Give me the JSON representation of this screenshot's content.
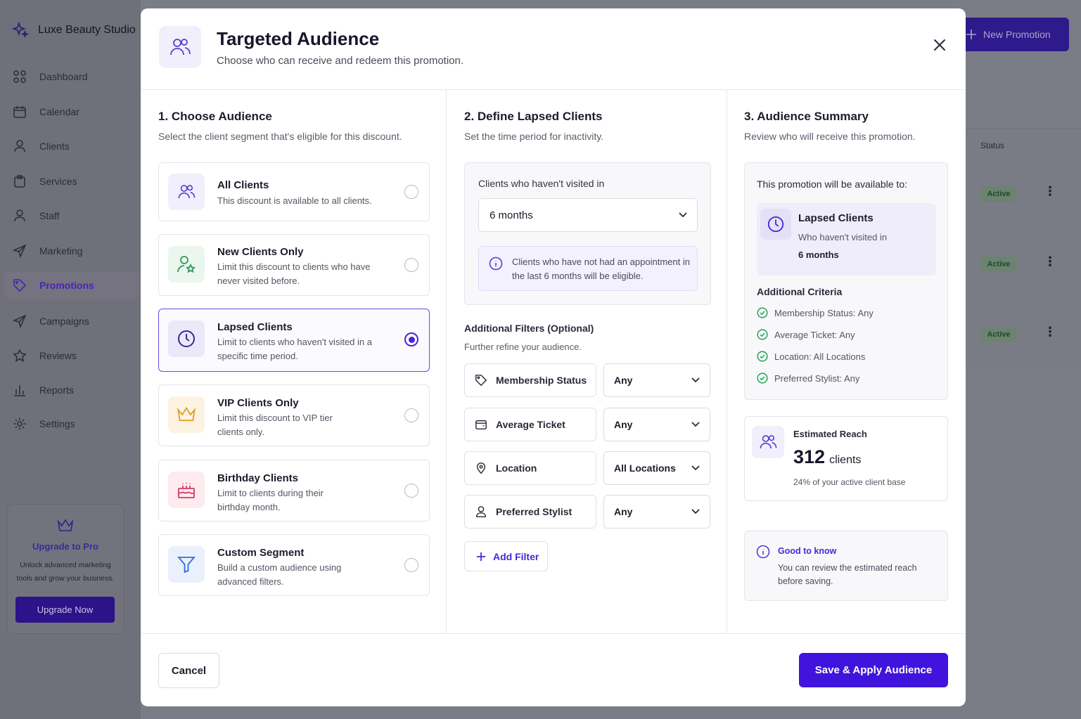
{
  "app": {
    "brand": "Luxe Beauty Studio",
    "new_promotion": "New Promotion",
    "nav": [
      {
        "label": "Dashboard"
      },
      {
        "label": "Calendar"
      },
      {
        "label": "Clients"
      },
      {
        "label": "Services"
      },
      {
        "label": "Staff"
      },
      {
        "label": "Marketing"
      },
      {
        "label": "Promotions",
        "active": true
      },
      {
        "label": "Campaigns"
      },
      {
        "label": "Reviews"
      },
      {
        "label": "Reports"
      },
      {
        "label": "Settings"
      }
    ],
    "upgrade": {
      "title": "Upgrade to Pro",
      "text": "Unlock advanced marketing tools and grow your business.",
      "button": "Upgrade Now"
    },
    "table": {
      "status_header": "Status",
      "rows": [
        {
          "status": "Active"
        },
        {
          "status": "Active"
        },
        {
          "status": "Active"
        }
      ]
    }
  },
  "modal": {
    "title": "Targeted Audience",
    "subtitle": "Choose who can receive and redeem this promotion.",
    "step1": {
      "heading": "1. Choose Audience",
      "sub": "Select the client segment that's eligible for this discount.",
      "options": [
        {
          "title": "All Clients",
          "desc": "This discount is available to all clients.",
          "icon": "users-icon",
          "selected": false
        },
        {
          "title": "New Clients Only",
          "desc": "Limit this discount to clients who have never visited before.",
          "icon": "user-star-icon",
          "selected": false
        },
        {
          "title": "Lapsed Clients",
          "desc": "Limit to clients who haven't visited in a specific time period.",
          "icon": "clock-icon",
          "selected": true
        },
        {
          "title": "VIP Clients Only",
          "desc": "Limit this discount to VIP tier clients only.",
          "icon": "crown-icon",
          "selected": false
        },
        {
          "title": "Birthday Clients",
          "desc": "Limit to clients during their birthday month.",
          "icon": "cake-icon",
          "selected": false
        },
        {
          "title": "Custom Segment",
          "desc": "Build a custom audience using advanced filters.",
          "icon": "filter-icon",
          "selected": false
        }
      ]
    },
    "step2": {
      "heading": "2. Define Lapsed Clients",
      "sub": "Set the time period for inactivity.",
      "period_label": "Clients who haven't visited in",
      "period_value": "6 months",
      "info": "Clients who have not had an appointment in the last 6 months will be eligible.",
      "filters_heading": "Additional Filters (Optional)",
      "filters_sub": "Further refine your audience.",
      "filters": [
        {
          "name": "Membership Status",
          "value": "Any",
          "icon": "tag-icon"
        },
        {
          "name": "Average Ticket",
          "value": "Any",
          "icon": "wallet-icon"
        },
        {
          "name": "Location",
          "value": "All Locations",
          "icon": "location-pin-icon"
        },
        {
          "name": "Preferred Stylist",
          "value": "Any",
          "icon": "user-icon"
        }
      ],
      "add_filter": "Add Filter"
    },
    "step3": {
      "heading": "3. Audience Summary",
      "sub": "Review who will receive this promotion.",
      "available_to": "This promotion will be available to:",
      "segment_title": "Lapsed Clients",
      "segment_desc": "Who haven't visited in",
      "segment_value": "6 months",
      "criteria_heading": "Additional Criteria",
      "criteria": [
        "Membership Status: Any",
        "Average Ticket: Any",
        "Location: All Locations",
        "Preferred Stylist: Any"
      ],
      "reach_label": "Estimated Reach",
      "reach_count": "312",
      "reach_unit": "clients",
      "reach_note": "24% of your active client base",
      "good_title": "Good to know",
      "good_text": "You can review the estimated reach before saving."
    },
    "cancel": "Cancel",
    "save": "Save & Apply Audience"
  },
  "colors": {
    "accent": "#4014dd",
    "check": "#2fa864"
  }
}
